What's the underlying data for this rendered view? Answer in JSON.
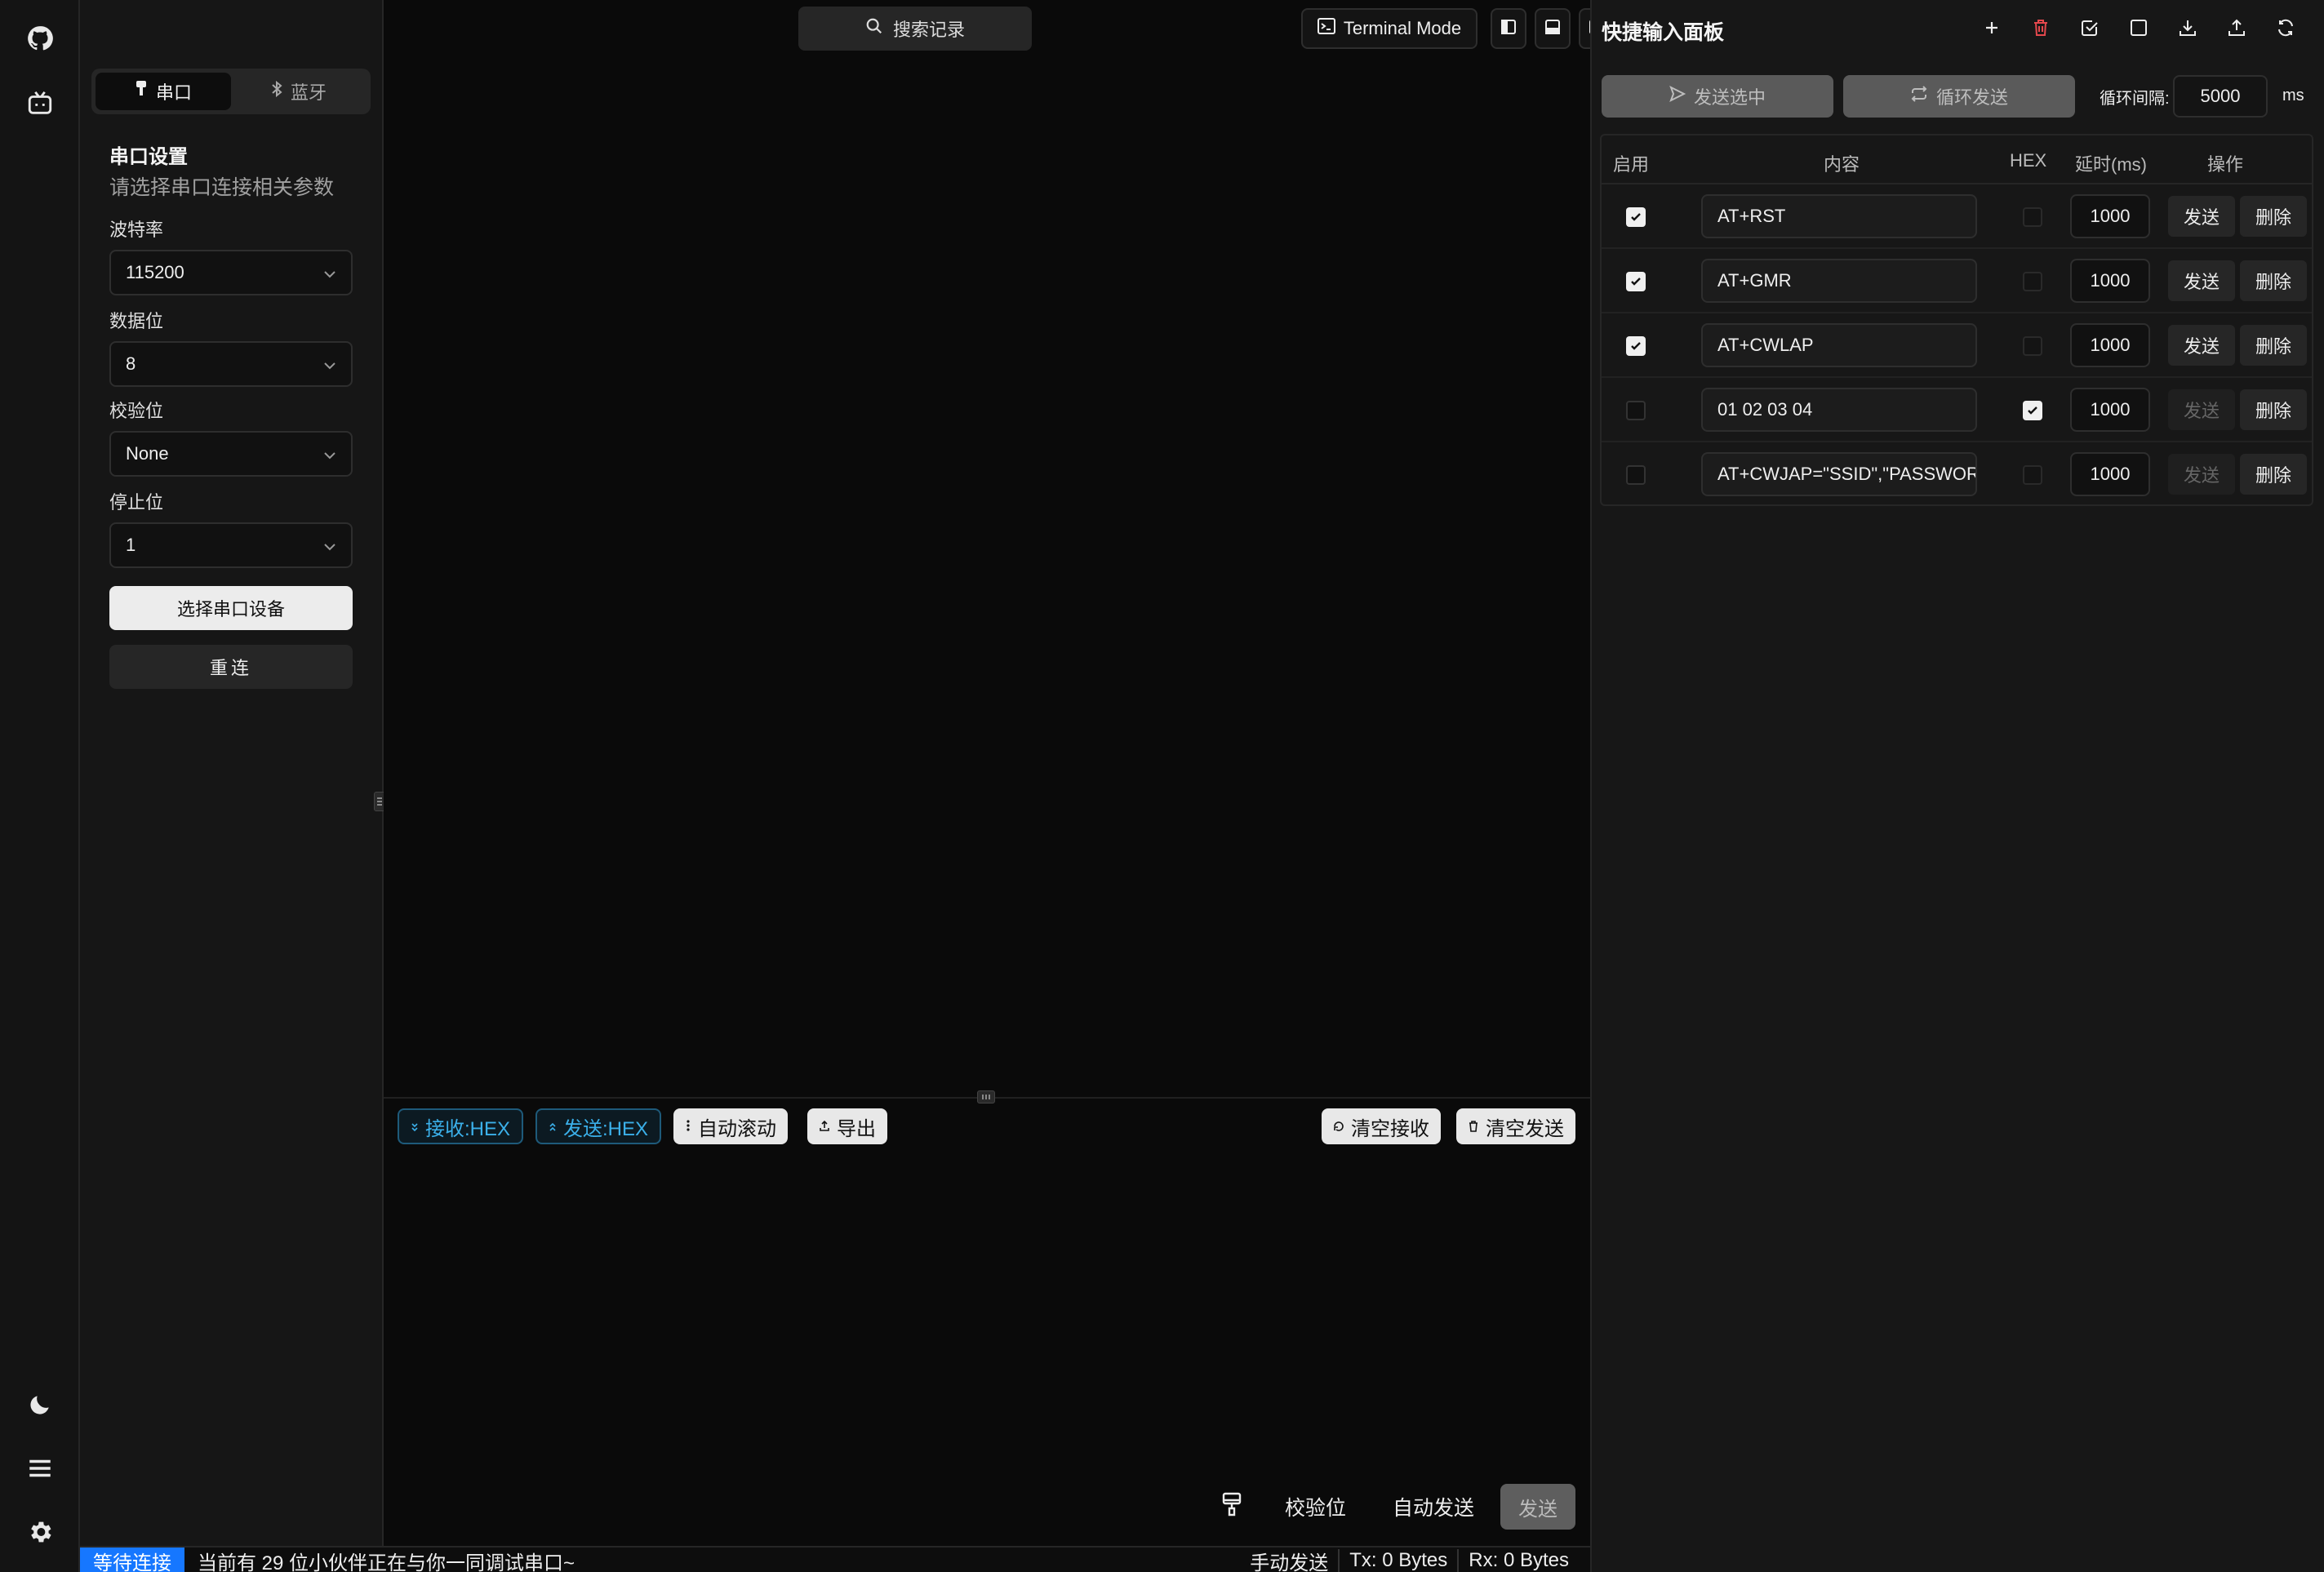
{
  "rail": {
    "icons": [
      "github-icon",
      "bilibili-icon",
      "moon-icon",
      "menu-icon",
      "gear-icon"
    ]
  },
  "connection_tabs": [
    {
      "label": "串口",
      "icon": "plug-icon",
      "active": true
    },
    {
      "label": "蓝牙",
      "icon": "bluetooth-icon",
      "active": false
    }
  ],
  "serial_settings": {
    "title": "串口设置",
    "subtitle": "请选择串口连接相关参数",
    "fields": [
      {
        "label": "波特率",
        "value": "115200"
      },
      {
        "label": "数据位",
        "value": "8"
      },
      {
        "label": "校验位",
        "value": "None"
      },
      {
        "label": "停止位",
        "value": "1"
      }
    ],
    "select_device_label": "选择串口设备",
    "reconnect_label": "重连"
  },
  "topbar": {
    "search_label": "搜索记录",
    "terminal_mode_label": "Terminal Mode"
  },
  "terminal_toolbar": {
    "recv_hex": "接收:HEX",
    "send_hex": "发送:HEX",
    "auto_scroll": "自动滚动",
    "export": "导出",
    "clear_recv": "清空接收",
    "clear_send": "清空发送"
  },
  "send_bar": {
    "checksum_label": "校验位",
    "auto_send_label": "自动发送",
    "send_label": "发送"
  },
  "statusbar": {
    "state": "等待连接",
    "message": "当前有 29 位小伙伴正在与你一同调试串口~",
    "mode": "手动发送",
    "tx": "Tx: 0 Bytes",
    "rx": "Rx: 0 Bytes"
  },
  "quick_panel": {
    "title": "快捷输入面板",
    "send_selected_label": "发送选中",
    "loop_send_label": "循环发送",
    "interval_label": "循环间隔:",
    "interval_value": "5000",
    "interval_unit": "ms",
    "columns": [
      "启用",
      "内容",
      "HEX",
      "延时(ms)",
      "操作"
    ],
    "rows": [
      {
        "enabled": true,
        "content": "AT+RST",
        "hex": false,
        "delay": "1000",
        "send": "发送",
        "delete": "删除"
      },
      {
        "enabled": true,
        "content": "AT+GMR",
        "hex": false,
        "delay": "1000",
        "send": "发送",
        "delete": "删除"
      },
      {
        "enabled": true,
        "content": "AT+CWLAP",
        "hex": false,
        "delay": "1000",
        "send": "发送",
        "delete": "删除"
      },
      {
        "enabled": false,
        "content": "01 02 03 04",
        "hex": true,
        "delay": "1000",
        "send": "发送",
        "delete": "删除"
      },
      {
        "enabled": false,
        "content": "AT+CWJAP=\"SSID\",\"PASSWORD\"",
        "hex": false,
        "delay": "1000",
        "send": "发送",
        "delete": "删除"
      }
    ]
  },
  "colors": {
    "accent_blue": "#1677ff",
    "hex_toggle_cyan": "#3bb0ea",
    "trash_red": "#e5484d"
  }
}
